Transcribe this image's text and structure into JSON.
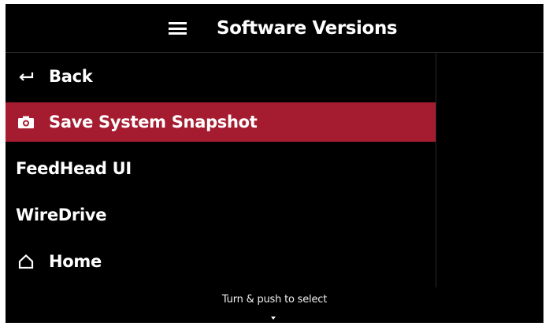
{
  "header": {
    "title": "Software Versions",
    "menu_icon": "hamburger-menu-icon"
  },
  "menu": {
    "items": [
      {
        "label": "Back",
        "icon": "back-arrow-icon",
        "selected": false
      },
      {
        "label": "Save System Snapshot",
        "icon": "camera-icon",
        "selected": true
      },
      {
        "label": "FeedHead UI",
        "icon": null,
        "selected": false
      },
      {
        "label": "WireDrive",
        "icon": null,
        "selected": false
      },
      {
        "label": "Home",
        "icon": "home-icon",
        "selected": false
      }
    ]
  },
  "footer": {
    "hint": "Turn & push to select",
    "indicator_icon": "caret-down-icon"
  },
  "colors": {
    "background": "#000000",
    "selection": "#a51c30",
    "text": "#ffffff"
  }
}
